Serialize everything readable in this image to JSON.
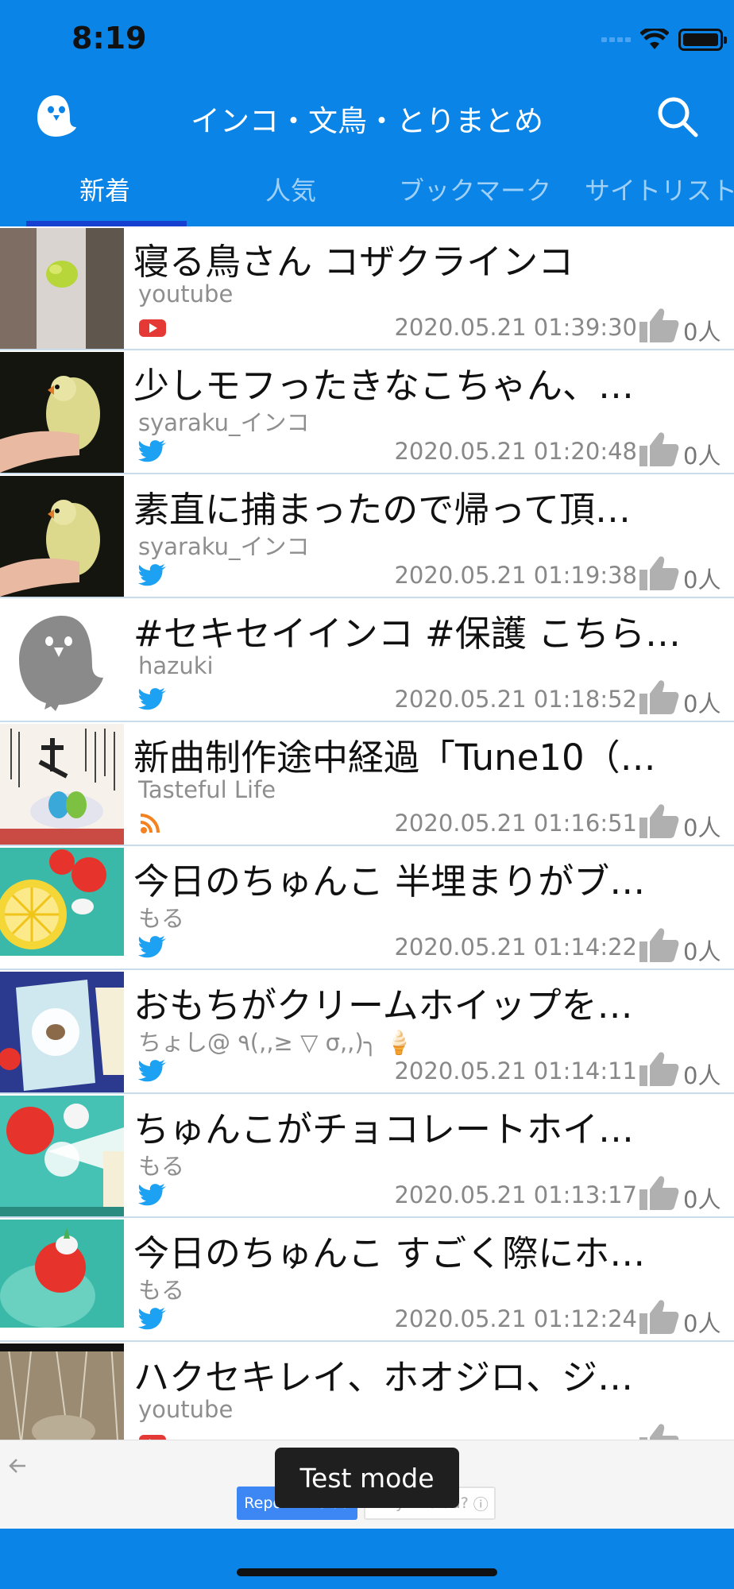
{
  "status_bar": {
    "time": "8:19"
  },
  "header": {
    "title": "インコ・文鳥・とりまとめ"
  },
  "tabs": [
    {
      "label": "新着"
    },
    {
      "label": "人気"
    },
    {
      "label": "ブックマーク"
    },
    {
      "label": "サイトリスト"
    }
  ],
  "items": [
    {
      "title": "寝る鳥さん コザクラインコ",
      "source": "youtube",
      "date": "2020.05.21 01:39:30",
      "likes": "0人"
    },
    {
      "title": "少しモフったきなこちゃん、…",
      "source": "syaraku_インコ",
      "date": "2020.05.21 01:20:48",
      "likes": "0人"
    },
    {
      "title": "素直に捕まったので帰って頂…",
      "source": "syaraku_インコ",
      "date": "2020.05.21 01:19:38",
      "likes": "0人"
    },
    {
      "title": "#セキセイインコ #保護 こちら…",
      "source": "hazuki",
      "date": "2020.05.21 01:18:52",
      "likes": "0人"
    },
    {
      "title": "新曲制作途中経過「Tune10（…",
      "source": "Tasteful Life",
      "date": "2020.05.21 01:16:51",
      "likes": "0人"
    },
    {
      "title": "今日のちゅんこ 半埋まりがブ…",
      "source": "もる",
      "date": "2020.05.21 01:14:22",
      "likes": "0人"
    },
    {
      "title": "おもちがクリームホイップを…",
      "source": "ちょし@ ٩(,,≥ ▽ σ,,)╮ 🍦",
      "date": "2020.05.21 01:14:11",
      "likes": "0人"
    },
    {
      "title": "ちゅんこがチョコレートホイ…",
      "source": "もる",
      "date": "2020.05.21 01:13:17",
      "likes": "0人"
    },
    {
      "title": "今日のちゅんこ すごく際にホ…",
      "source": "もる",
      "date": "2020.05.21 01:12:24",
      "likes": "0人"
    },
    {
      "title": "ハクセキレイ、ホオジロ、ジ…",
      "source": "youtube",
      "date": "",
      "likes": ""
    }
  ],
  "ad": {
    "report_label": "Report this ad",
    "why_label": "Why this ad?",
    "toast": "Test mode"
  },
  "colors": {
    "header": "#0a84e6",
    "tab_indicator": "#1640d0",
    "youtube": "#e53935",
    "twitter": "#1da1f2",
    "rss": "#f58220"
  }
}
